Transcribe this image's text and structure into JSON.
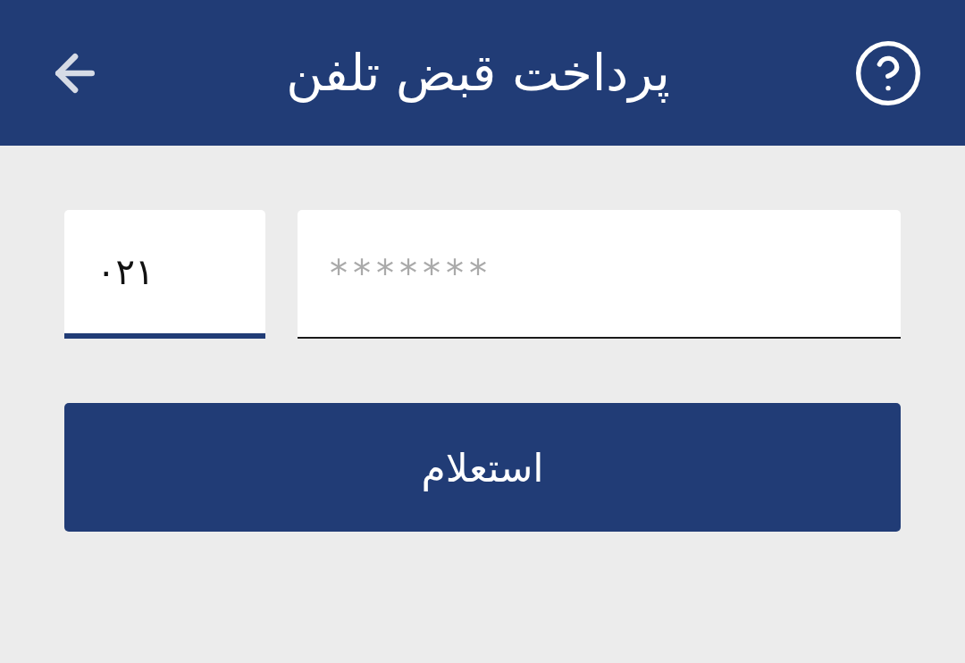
{
  "header": {
    "title": "پرداخت قبض تلفن"
  },
  "form": {
    "area_code": {
      "value": "۰۲۱",
      "focused": true
    },
    "phone": {
      "placeholder": "*******",
      "focused": false
    },
    "submit": {
      "label": "استعلام"
    }
  }
}
